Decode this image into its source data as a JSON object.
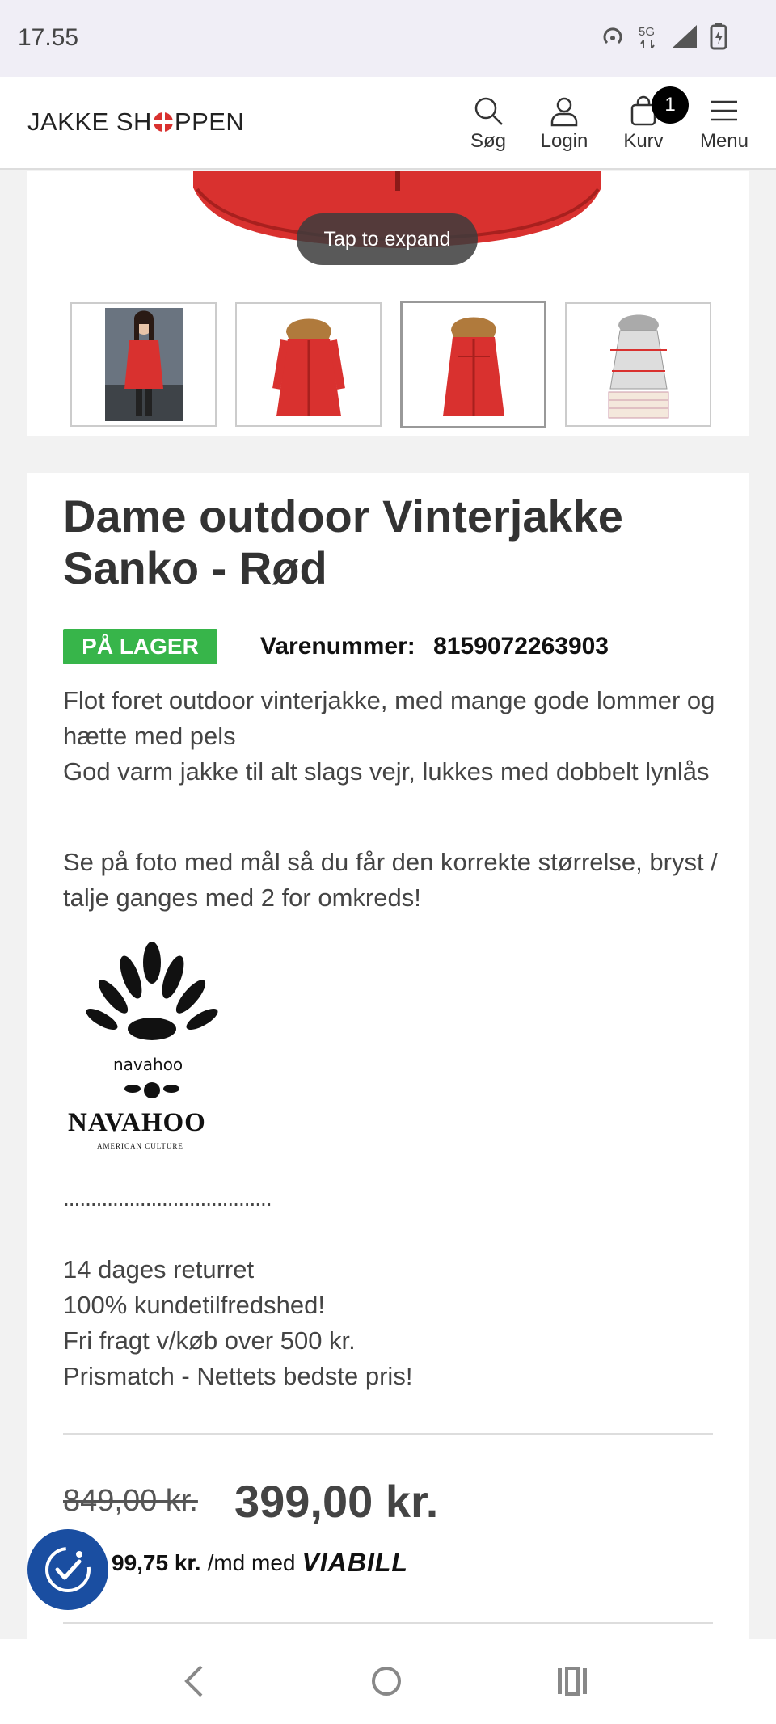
{
  "status_bar": {
    "time": "17.55",
    "icons": [
      "hotspot-icon",
      "5g-icon",
      "signal-icon",
      "battery-charging-icon"
    ]
  },
  "header": {
    "logo_text_start": "JAKKE SH",
    "logo_text_end": "PPEN",
    "nav": {
      "search_label": "Søg",
      "login_label": "Login",
      "cart_label": "Kurv",
      "cart_count": "1",
      "menu_label": "Menu"
    }
  },
  "gallery": {
    "tap_to_expand": "Tap to expand",
    "thumbnail_count": 4,
    "active_thumbnail": 3
  },
  "product": {
    "title": "Dame outdoor Vinterjakke Sanko - Rød",
    "stock_badge": "PÅ LAGER",
    "sku_label": "Varenummer:",
    "sku_value": "8159072263903",
    "description_1": "Flot foret outdoor vinterjakke, med mange gode lommer og hætte med pels",
    "description_2": "God varm jakke til alt slags vejr, lukkes med dobbelt lynlås",
    "description_3": "Se på foto med mål så du får den korrekte størrelse, bryst / talje ganges med 2 for omkreds!",
    "brand_small": "navahoo",
    "brand_name": "NAVAHOO",
    "brand_tagline": "AMERICAN CULTURE",
    "separator": "......................................",
    "perk_1": "14 dages returret",
    "perk_2": "100% kundetilfredshed!",
    "perk_3": "Fri fragt v/køb over 500 kr.",
    "perk_4": "Prismatch - Nettets bedste pris!",
    "old_price": "849,00 kr.",
    "price": "399,00 kr.",
    "monthly_amount": "99,75 kr.",
    "monthly_suffix": "/md med",
    "monthly_provider": "VIABILL"
  },
  "colors": {
    "stock_green": "#37b54a",
    "jacket_red": "#d9312f",
    "accessibility_blue": "#1a4ea1"
  }
}
